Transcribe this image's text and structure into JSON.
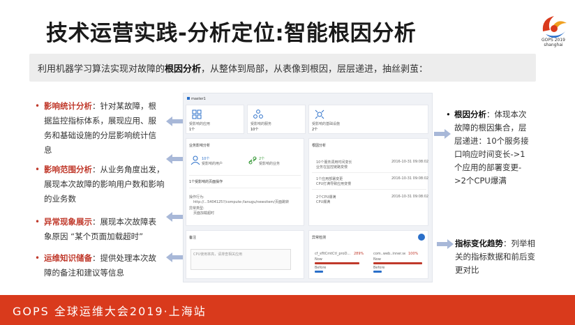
{
  "title": "技术运营实践-分析定位:智能根因分析",
  "logo": {
    "line1": "GOPS 2019",
    "line2": "shanghai",
    "colors": [
      "#d93a1c",
      "#f0a020",
      "#2a6fc9"
    ]
  },
  "subtitle": {
    "before": "利用机器学习算法实现对故障的",
    "bold": "根因分析",
    "after": "，从整体到局部，从表像到根因，层层递进，抽丝剥茧："
  },
  "left_items": [
    {
      "key": "影响统计分析",
      "line1_rest": "：针对某故障，根",
      "lines": [
        "据监控指标体系，展现应用、服",
        "务和基础设施的分层影响统计信",
        "息"
      ]
    },
    {
      "key": "影响范围分析",
      "line1_rest": "：从业务角度出发，",
      "lines": [
        "展现本次故障的影响用户数和影响",
        "的业务数"
      ]
    },
    {
      "key": "异常现象展示",
      "line1_rest": "：展现本次故障表",
      "lines": [
        "象原因 “某个页面加载超时”"
      ]
    },
    {
      "key": "运维知识储备",
      "line1_rest": "：提供处理本次故",
      "lines": [
        "障的备注和建议等信息"
      ]
    }
  ],
  "right_items": [
    {
      "key": "根因分析",
      "line1_rest": "：体现本次",
      "lines": [
        "故障的根因集合，层",
        "层递进：10个服务接",
        "口响应时间变长->1",
        "个应用的部署变更-",
        ">2个CPU爆满"
      ]
    },
    {
      "key": "指标变化趋势",
      "line1_rest": "：列举相",
      "lines": [
        "关的指标数据和前后变",
        "更对比"
      ]
    }
  ],
  "dashboard": {
    "header": "master1",
    "stats": [
      {
        "label": "受影响的应用",
        "value": "1个"
      },
      {
        "label": "受影响的服务",
        "value": "10个"
      },
      {
        "label": "受影响的基础设施",
        "value": "2个"
      }
    ],
    "impact_title": "业务影响分析",
    "impact_users": {
      "value": "10个",
      "label": "受影响的用户"
    },
    "impact_services": {
      "value": "2个",
      "label": "受影响的业务"
    },
    "anomaly_line": "1个受影响的页面操作",
    "detail_label1": "操作行为:",
    "detail_value1": "http://...5404125?/compute-/lanugu/newsitem/页面跳转",
    "detail_label2": "异常类型:",
    "detail_value2": "页面加载超时",
    "root_title": "根因分析",
    "root_rows": [
      {
        "text": "10个服务调用时间变长",
        "sub": "业务在监控链路变慢",
        "time": "2016-10-31 09:08:02"
      },
      {
        "text": "1个应用部署变更",
        "sub": "CPU打满导致应用变慢",
        "time": "2016-10-31 09:08:02"
      },
      {
        "text": "2个CPU爆满",
        "sub": "CPU爆满",
        "time": "2016-10-31 09:08:02"
      }
    ],
    "notes_title": "备注",
    "notes_placeholder": "CPU使用率高，请排查相关应用",
    "metrics_title": "异常检测",
    "metric1": {
      "name": "cf_sfltCmtCtl_proD...",
      "value": "289%",
      "now": "Now",
      "before": "Before"
    },
    "metric2": {
      "name": "com..web..inner.ser...",
      "value": "100%",
      "now": "Now",
      "before": "Before"
    }
  },
  "footer": "GOPS 全球运维大会2019·上海站",
  "colors": {
    "accent": "#c0392b",
    "footer": "#d93a1c",
    "arrow": "#a8b8d8"
  }
}
